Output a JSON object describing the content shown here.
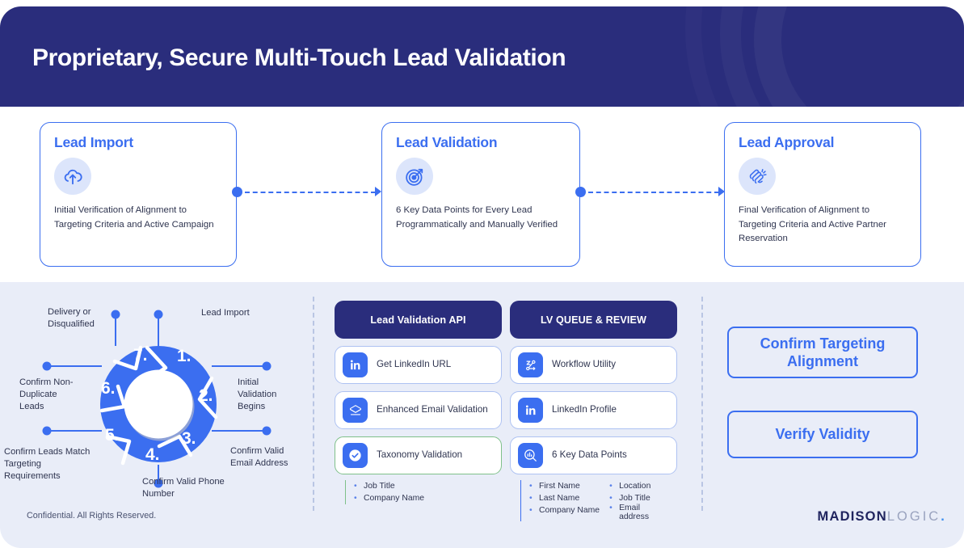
{
  "header": {
    "title": "Proprietary, Secure Multi-Touch Lead Validation",
    "bg_color": "#2a2d7c"
  },
  "steps": [
    {
      "title": "Lead Import",
      "icon": "cloud-upload-icon",
      "desc": "Initial Verification of Alignment to Targeting Criteria and Active Campaign"
    },
    {
      "title": "Lead Validation",
      "icon": "target-arrow-icon",
      "desc": "6 Key Data Points for Every Lead Programmatically and Manually Verified"
    },
    {
      "title": "Lead Approval",
      "icon": "clapping-hands-icon",
      "desc": "Final Verification of Alignment to Targeting Criteria and Active Partner Reservation"
    }
  ],
  "wheel": {
    "segments": [
      {
        "number": "1.",
        "label": "Lead Import"
      },
      {
        "number": "2.",
        "label": "Initial Validation Begins"
      },
      {
        "number": "3.",
        "label": "Confirm Valid Email Address"
      },
      {
        "number": "4.",
        "label": "Confirm Valid Phone Number"
      },
      {
        "number": "5.",
        "label": "Confirm Leads Match Targeting Requirements"
      },
      {
        "number": "6.",
        "label": "Confirm Non-Duplicate Leads"
      },
      {
        "number": "7.",
        "label": "Delivery or Disqualified"
      }
    ],
    "color": "#3b6ef0"
  },
  "columns": [
    {
      "heading": "Lead Validation API",
      "rows": [
        {
          "label": "Get LinkedIn URL",
          "icon": "linkedin-icon",
          "highlight": false
        },
        {
          "label": "Enhanced Email Validation",
          "icon": "email-validation-icon",
          "highlight": false
        },
        {
          "label": "Taxonomy Validation",
          "icon": "check-circle-icon",
          "highlight": true
        }
      ],
      "bullets_left": [
        "Job Title",
        "Company Name"
      ],
      "bullets_right": []
    },
    {
      "heading": "LV QUEUE & REVIEW",
      "rows": [
        {
          "label": "Workflow Utility",
          "icon": "workflow-icon",
          "highlight": false
        },
        {
          "label": "LinkedIn Profile",
          "icon": "linkedin-icon",
          "highlight": false
        },
        {
          "label": "6 Key Data Points",
          "icon": "data-search-icon",
          "highlight": false
        }
      ],
      "bullets_left": [
        "First Name",
        "Last Name",
        "Company Name"
      ],
      "bullets_right": [
        "Location",
        "Job Title",
        "Email address"
      ]
    }
  ],
  "cta_buttons": [
    {
      "label": "Confirm Targeting Alignment"
    },
    {
      "label": "Verify Validity"
    }
  ],
  "footer": {
    "confidential": "Confidential. All Rights Reserved.",
    "logo_bold": "MADISON",
    "logo_light": "LOGIC",
    "logo_dot": "."
  },
  "colors": {
    "navy": "#2a2d7c",
    "blue": "#3b6ef0",
    "panel": "#e9edf8",
    "green": "#7fc08a"
  }
}
